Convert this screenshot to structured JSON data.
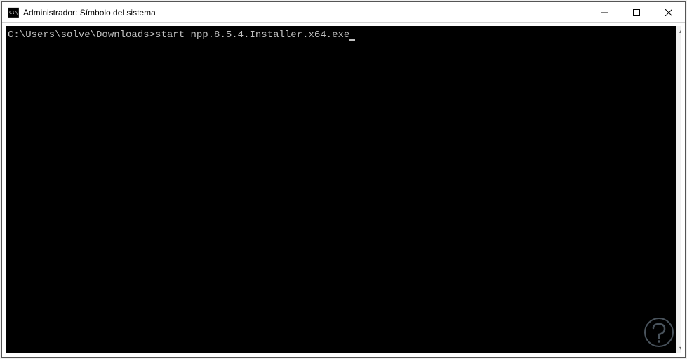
{
  "window": {
    "title": "Administrador: Símbolo del sistema"
  },
  "terminal": {
    "prompt": "C:\\Users\\solve\\Downloads>",
    "command": "start npp.8.5.4.Installer.x64.exe"
  }
}
